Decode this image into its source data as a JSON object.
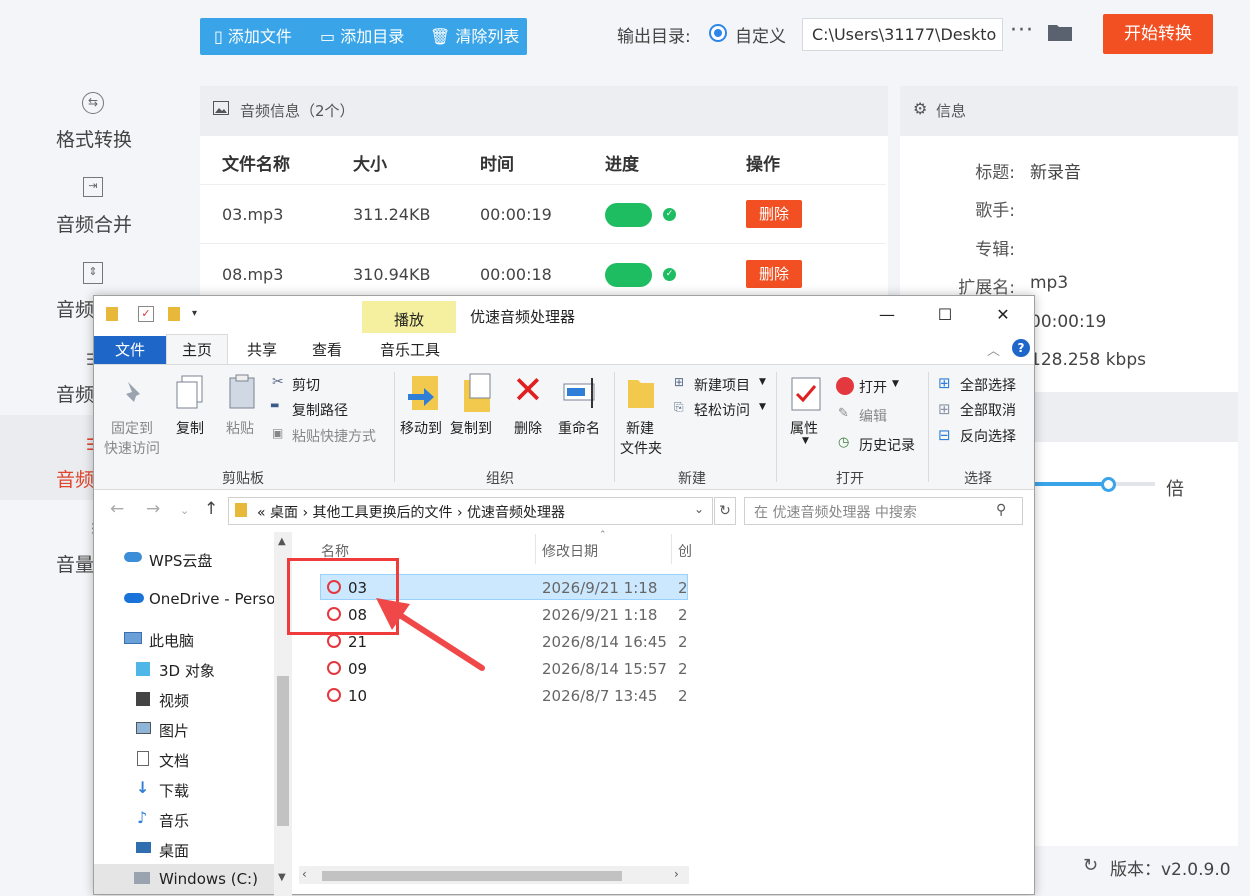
{
  "sidebar": {
    "items": [
      {
        "label": "格式转换",
        "icon": "format-convert-icon"
      },
      {
        "label": "音频合并",
        "icon": "audio-merge-icon"
      },
      {
        "label": "音频",
        "icon": "audio-split-icon"
      },
      {
        "label": "音频",
        "icon": "audio-settings-icon"
      },
      {
        "label": "音频",
        "icon": "audio-active-icon"
      },
      {
        "label": "音量",
        "icon": "volume-icon"
      }
    ]
  },
  "toolbar": {
    "add_file": "添加文件",
    "add_dir": "添加目录",
    "clear_list": "清除列表",
    "output_label": "输出目录:",
    "custom_label": "自定义",
    "output_path": "C:\\Users\\31177\\Deskto",
    "more": "···",
    "start": "开始转换"
  },
  "list": {
    "title": "音频信息（2个）",
    "headers": {
      "name": "文件名称",
      "size": "大小",
      "time": "时间",
      "progress": "进度",
      "action": "操作"
    },
    "rows": [
      {
        "name": "03.mp3",
        "size": "311.24KB",
        "time": "00:00:19",
        "action": "删除"
      },
      {
        "name": "08.mp3",
        "size": "310.94KB",
        "time": "00:00:18",
        "action": "删除"
      }
    ]
  },
  "info": {
    "title": "信息",
    "fields": [
      {
        "key": "标题:",
        "value": "新录音"
      },
      {
        "key": "歌手:",
        "value": ""
      },
      {
        "key": "专辑:",
        "value": ""
      },
      {
        "key": "扩展名:",
        "value": "mp3"
      },
      {
        "key": "",
        "value": "00:00:19"
      },
      {
        "key": "",
        "value": "128.258 kbps"
      }
    ],
    "speed_unit": "倍",
    "version": "版本：v2.0.9.0"
  },
  "explorer": {
    "title": "优速音频处理器",
    "play_tab": "播放",
    "tabs": [
      "文件",
      "主页",
      "共享",
      "查看",
      "音乐工具"
    ],
    "ribbon": {
      "pin": [
        "固定到",
        "快速访问"
      ],
      "copy": "复制",
      "paste": "粘贴",
      "cut": "剪切",
      "copy_path": "复制路径",
      "paste_shortcut": "粘贴快捷方式",
      "group_clipboard": "剪贴板",
      "move_to": "移动到",
      "copy_to": "复制到",
      "delete": "删除",
      "rename": "重命名",
      "group_organize": "组织",
      "new_folder": [
        "新建",
        "文件夹"
      ],
      "new_item": "新建项目",
      "easy_access": "轻松访问",
      "group_new": "新建",
      "properties": "属性",
      "open": "打开",
      "edit": "编辑",
      "history": "历史记录",
      "group_open": "打开",
      "select_all": "全部选择",
      "select_none": "全部取消",
      "invert": "反向选择",
      "group_select": "选择"
    },
    "address": "«  桌面  ›  其他工具更换后的文件  ›  优速音频处理器",
    "search_placeholder": "在 优速音频处理器 中搜索",
    "nav": [
      "WPS云盘",
      "OneDrive - Person",
      "此电脑",
      "3D 对象",
      "视频",
      "图片",
      "文档",
      "下载",
      "音乐",
      "桌面",
      "Windows (C:)"
    ],
    "columns": {
      "name": "名称",
      "date": "修改日期",
      "type": "创"
    },
    "files": [
      {
        "name": "03",
        "date": "2026/9/21 1:18",
        "type": "2"
      },
      {
        "name": "08",
        "date": "2026/9/21 1:18",
        "type": "2"
      },
      {
        "name": "21",
        "date": "2026/8/14 16:45",
        "type": "2"
      },
      {
        "name": "09",
        "date": "2026/8/14 15:57",
        "type": "2"
      },
      {
        "name": "10",
        "date": "2026/8/7 13:45",
        "type": "2"
      }
    ]
  },
  "colors": {
    "accent": "#3aa4e9",
    "start": "#f25022",
    "progress": "#1fbd62",
    "annotation": "#f03b3b"
  }
}
